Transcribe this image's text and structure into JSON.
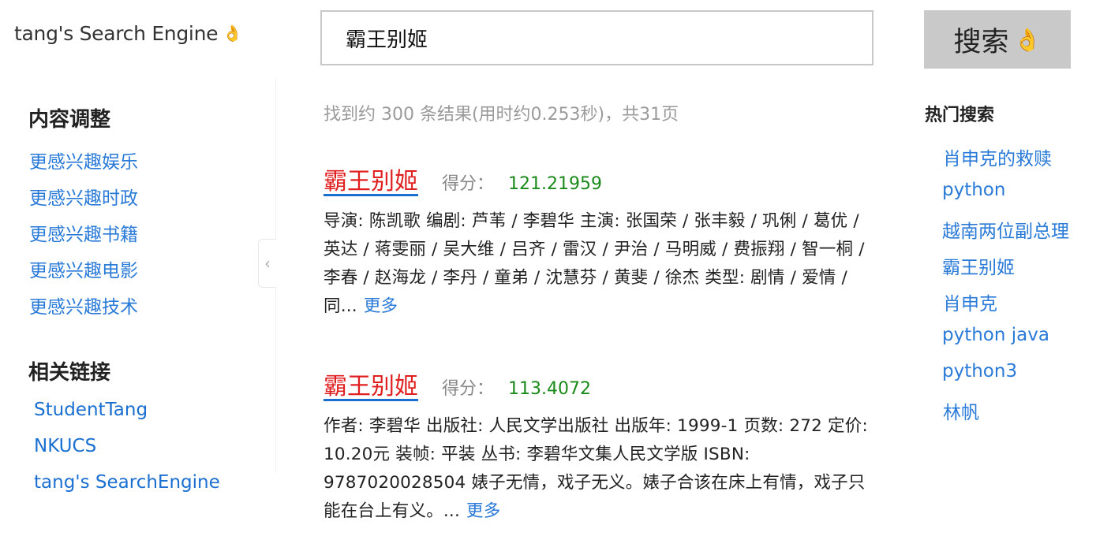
{
  "header": {
    "logo_text": "tang's Search Engine",
    "search_value": "霸王别姬",
    "search_button": "搜索"
  },
  "left": {
    "content_title": "内容调整",
    "content_links": [
      "更感兴趣娱乐",
      "更感兴趣时政",
      "更感兴趣书籍",
      "更感兴趣电影",
      "更感兴趣技术"
    ],
    "related_title": "相关链接",
    "related_links": [
      "StudentTang",
      "NKUCS",
      "tang's SearchEngine"
    ]
  },
  "stats": "找到约 300  条结果(用时约0.253秒)，共31页",
  "results": [
    {
      "title": "霸王别姬",
      "score_label": "得分：",
      "score": "121.21959",
      "snippet": "导演: 陈凯歌 编剧: 芦苇 / 李碧华 主演: 张国荣 / 张丰毅 / 巩俐 / 葛优 / 英达 / 蒋雯丽 / 吴大维 / 吕齐 / 雷汉 / 尹治 / 马明威 / 费振翔 / 智一桐 / 李春 / 赵海龙 / 李丹 / 童弟 / 沈慧芬 / 黄斐 / 徐杰 类型: 剧情 / 爱情 / 同...",
      "more": "更多"
    },
    {
      "title": "霸王别姬",
      "score_label": "得分：",
      "score": "113.4072",
      "snippet": "作者: 李碧华 出版社: 人民文学出版社 出版年: 1999-1 页数: 272 定价: 10.20元 装帧: 平装 丛书: 李碧华文集人民文学版 ISBN: 9787020028504 婊子无情，戏子无义。婊子合该在床上有情，戏子只能在台上有义。...",
      "more": "更多"
    }
  ],
  "hot": {
    "title": "热门搜索",
    "items": [
      "肖申克的救赎",
      "python",
      "越南两位副总理",
      "霸王别姬",
      "肖申克",
      "python java",
      "python3",
      "林帆"
    ]
  }
}
